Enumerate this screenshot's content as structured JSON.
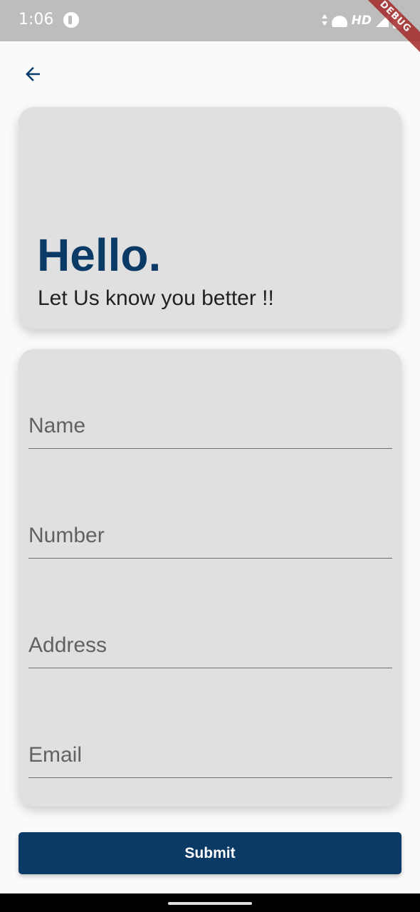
{
  "status_bar": {
    "time": "1:06",
    "network_label": "HD",
    "icons": [
      "app-notification-icon",
      "data-arrows-icon",
      "wifi-icon",
      "signal-icon",
      "battery-icon"
    ]
  },
  "debug_banner": {
    "label": "DEBUG"
  },
  "header": {
    "back_icon": "arrow-back-icon"
  },
  "hero": {
    "title": "Hello.",
    "subtitle": "Let Us know you better !!"
  },
  "form": {
    "fields": [
      {
        "placeholder": "Name",
        "value": ""
      },
      {
        "placeholder": "Number",
        "value": ""
      },
      {
        "placeholder": "Address",
        "value": ""
      },
      {
        "placeholder": "Email",
        "value": ""
      }
    ]
  },
  "actions": {
    "submit_label": "Submit"
  },
  "colors": {
    "primary": "#0b3a66",
    "card_background": "#e0e0e0",
    "page_background": "#fafafa",
    "status_bar": "#bdbdbd"
  }
}
